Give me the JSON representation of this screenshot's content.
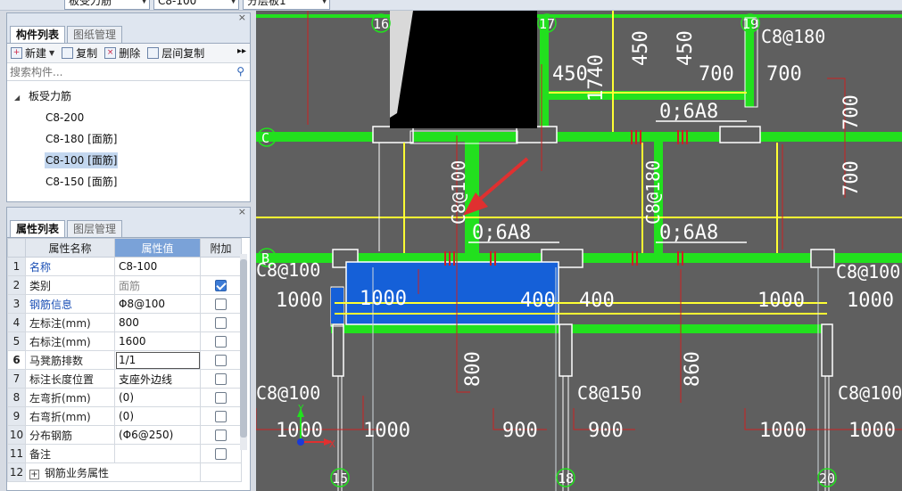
{
  "topbar": {
    "dropdown_1_value": "板受力筋",
    "dropdown_2_value": "C8-100",
    "dropdown_3_value": "分层板1"
  },
  "component_panel": {
    "tabs": [
      {
        "label": "构件列表",
        "active": true
      },
      {
        "label": "图纸管理",
        "active": false
      }
    ],
    "toolbar": {
      "new_label": "新建",
      "copy_label": "复制",
      "delete_label": "删除",
      "floor_copy_label": "层间复制"
    },
    "search_placeholder": "搜索构件...",
    "tree": {
      "root": "板受力筋",
      "items": [
        {
          "label": "C8-200",
          "selected": false
        },
        {
          "label": "C8-180 [面筋]",
          "selected": false
        },
        {
          "label": "C8-100 [面筋]",
          "selected": true
        },
        {
          "label": "C8-150 [面筋]",
          "selected": false
        }
      ]
    }
  },
  "property_panel": {
    "tabs": [
      {
        "label": "属性列表",
        "active": true
      },
      {
        "label": "图层管理",
        "active": false
      }
    ],
    "headers": {
      "name": "属性名称",
      "value": "属性值",
      "extra": "附加"
    },
    "rows": [
      {
        "no": "1",
        "name": "名称",
        "value": "C8-100",
        "blue": true,
        "checkbox": null
      },
      {
        "no": "2",
        "name": "类别",
        "value": "面筋",
        "blue": false,
        "checkbox": true
      },
      {
        "no": "3",
        "name": "钢筋信息",
        "value": "Φ8@100",
        "blue": true,
        "checkbox": false
      },
      {
        "no": "4",
        "name": "左标注(mm)",
        "value": "800",
        "blue": false,
        "checkbox": false
      },
      {
        "no": "5",
        "name": "右标注(mm)",
        "value": "1600",
        "blue": false,
        "checkbox": false
      },
      {
        "no": "6",
        "name": "马凳筋排数",
        "value": "1/1",
        "blue": false,
        "checkbox": false
      },
      {
        "no": "7",
        "name": "标注长度位置",
        "value": "支座外边线",
        "blue": false,
        "checkbox": false
      },
      {
        "no": "8",
        "name": "左弯折(mm)",
        "value": "(0)",
        "blue": false,
        "checkbox": false
      },
      {
        "no": "9",
        "name": "右弯折(mm)",
        "value": "(0)",
        "blue": false,
        "checkbox": false
      },
      {
        "no": "10",
        "name": "分布钢筋",
        "value": "(Φ6@250)",
        "blue": false,
        "checkbox": false
      },
      {
        "no": "11",
        "name": "备注",
        "value": "",
        "blue": false,
        "checkbox": false
      },
      {
        "no": "12",
        "name": "钢筋业务属性",
        "value": "",
        "blue": false,
        "checkbox": null
      }
    ]
  },
  "drawing": {
    "axis_labels": {
      "a16": "16",
      "a17": "17",
      "a19": "19",
      "a15": "15",
      "a18": "18",
      "a20": "20",
      "aC": "C",
      "aB": "B"
    },
    "texts": {
      "t450a": "450",
      "t450b": "450",
      "t450c": "450",
      "t1740": "1740",
      "t700a": "700",
      "t700b": "700",
      "t700c": "700",
      "t700d": "700",
      "tC8_180_top": "C8@180",
      "t06A8_1": "0;6A8",
      "t06A8_2": "0;6A8",
      "t06A8_3": "0;6A8",
      "tC8_100_v": "C8@100",
      "tC8_180_v": "C8@180",
      "tC8_100_left": "C8@100",
      "tC8_100_right": "C8@100",
      "t1000a": "1000",
      "t1000b": "1000",
      "t400a": "400",
      "t400b": "400",
      "t1000c": "1000",
      "t1000d": "1000",
      "t800": "800",
      "t860": "860",
      "tC8_100_bl": "C8@100",
      "tC8_150": "C8@150",
      "tC8_100_br": "C8@100",
      "t1000e": "1000",
      "t1000f": "1000",
      "t900a": "900",
      "t900b": "900",
      "t1000g": "1000",
      "t1000h": "1000",
      "ucs_x": "X",
      "ucs_y": "Y"
    }
  },
  "colors": {
    "accent": "#7aa2d8",
    "cad_background": "#5f5f5f",
    "beam_green": "#22e01e",
    "rebar_yellow": "#ffff33",
    "selected_blue": "#1560d8",
    "dimension_red": "#cc2222"
  }
}
